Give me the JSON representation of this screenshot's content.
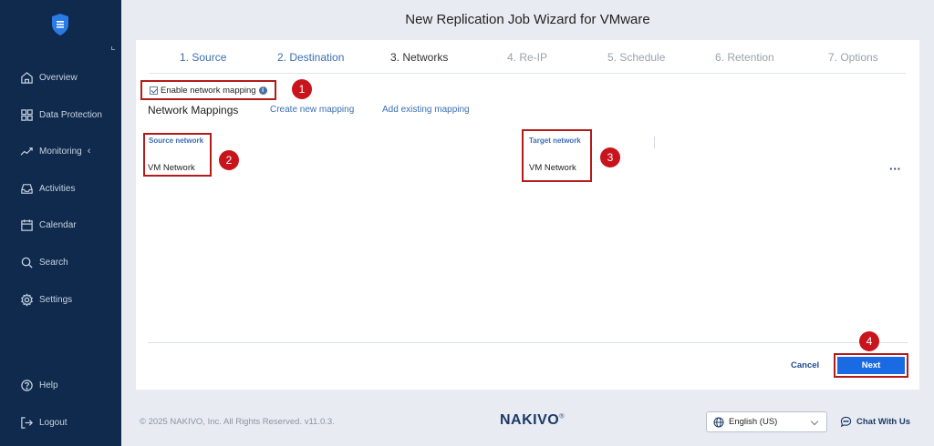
{
  "window": {
    "title": "New Replication Job Wizard for VMware"
  },
  "sidebar": {
    "items": [
      {
        "label": "Overview",
        "icon": "home-icon"
      },
      {
        "label": "Data Protection",
        "icon": "grid-icon"
      },
      {
        "label": "Monitoring",
        "icon": "activity-icon"
      },
      {
        "label": "Activities",
        "icon": "inbox-icon"
      },
      {
        "label": "Calendar",
        "icon": "calendar-icon"
      },
      {
        "label": "Search",
        "icon": "search-icon"
      },
      {
        "label": "Settings",
        "icon": "gear-icon"
      }
    ],
    "bottom": [
      {
        "label": "Help",
        "icon": "help-icon"
      },
      {
        "label": "Logout",
        "icon": "logout-icon"
      }
    ]
  },
  "wizard": {
    "steps": [
      {
        "label": "1. Source",
        "state": "done"
      },
      {
        "label": "2. Destination",
        "state": "done"
      },
      {
        "label": "3. Networks",
        "state": "active"
      },
      {
        "label": "4. Re-IP",
        "state": "todo"
      },
      {
        "label": "5. Schedule",
        "state": "todo"
      },
      {
        "label": "6. Retention",
        "state": "todo"
      },
      {
        "label": "7. Options",
        "state": "todo"
      }
    ],
    "enable_mapping_label": "Enable network mapping",
    "enable_mapping_checked": true,
    "mappings_title": "Network Mappings",
    "create_link": "Create new mapping",
    "add_link": "Add existing mapping",
    "table": {
      "headers": [
        "Source network",
        "Target network"
      ],
      "rows": [
        [
          "VM Network",
          "VM Network"
        ]
      ]
    },
    "more_actions": "···",
    "cancel_label": "Cancel",
    "next_label": "Next"
  },
  "annotations": [
    "1",
    "2",
    "3",
    "4"
  ],
  "footer": {
    "copyright": "© 2025 NAKIVO, Inc. All Rights Reserved. v11.0.3.",
    "brand": "NAKIVO",
    "brand_mark": "®",
    "language": "English (US)",
    "chat": "Chat With Us"
  },
  "colors": {
    "sidebar_bg": "#0f2a4c",
    "accent": "#1a6be3",
    "annotation_red": "#c8141c",
    "link_blue": "#3d6fb3"
  }
}
